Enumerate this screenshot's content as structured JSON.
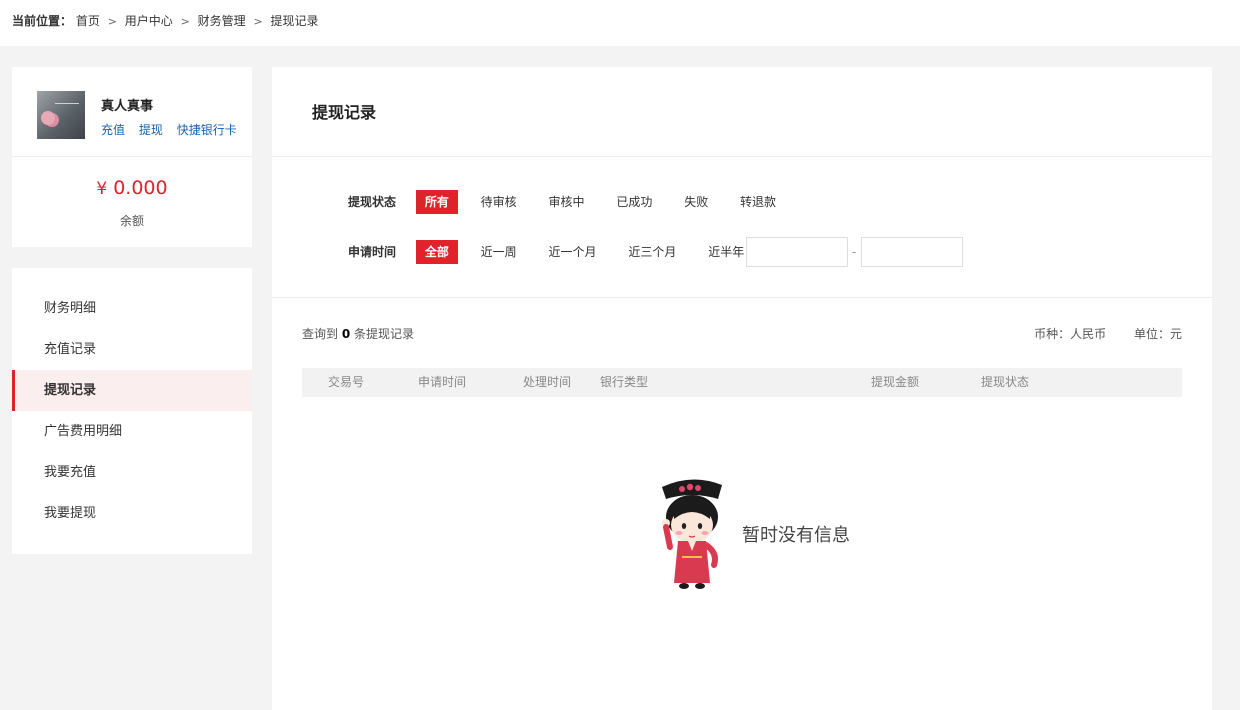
{
  "breadcrumb": {
    "label": "当前位置：",
    "items": [
      "首页",
      "用户中心",
      "财务管理",
      "提现记录"
    ],
    "separator": ">"
  },
  "user": {
    "name": "真人真事",
    "links": [
      "充值",
      "提现",
      "快捷银行卡"
    ],
    "balance_currency": "¥",
    "balance": "0.000",
    "balance_label": "余额"
  },
  "menu": {
    "items": [
      "财务明细",
      "充值记录",
      "提现记录",
      "广告费用明细",
      "我要充值",
      "我要提现"
    ],
    "active": "提现记录"
  },
  "main": {
    "title": "提现记录",
    "status_filter": {
      "label": "提现状态",
      "options": [
        "所有",
        "待审核",
        "审核中",
        "已成功",
        "失败",
        "转退款"
      ],
      "active": "所有"
    },
    "time_filter": {
      "label": "申请时间",
      "options": [
        "全部",
        "近一周",
        "近一个月",
        "近三个月",
        "近半年"
      ],
      "active": "全部",
      "date_separator": "-",
      "start_value": "",
      "end_value": ""
    },
    "result": {
      "prefix": "查询到",
      "count": "0",
      "suffix": "条提现记录"
    },
    "currency_info": "币种：人民币",
    "unit_info": "单位：元",
    "table_headers": [
      "交易号",
      "申请时间",
      "处理时间",
      "银行类型",
      "提现金额",
      "提现状态"
    ],
    "empty_text": "暂时没有信息"
  },
  "colors": {
    "accent": "#e0232b",
    "link": "#1a62b0",
    "page_bg": "#f3f3f3"
  }
}
